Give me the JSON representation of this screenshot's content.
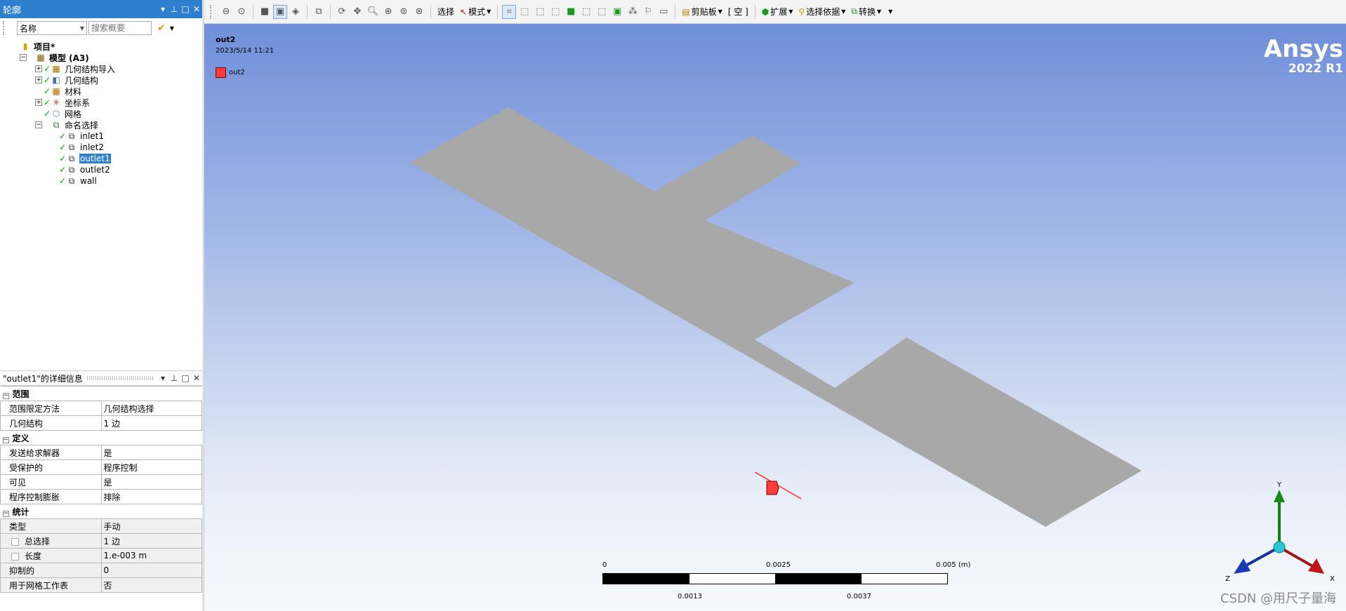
{
  "outline": {
    "title": "轮廓",
    "filter_select": "名称",
    "search_placeholder": "搜索概要",
    "tree": [
      {
        "label": "项目*",
        "bold": true,
        "icon": "project-icon",
        "depth": 0,
        "expander": "",
        "check": false
      },
      {
        "label": "模型 (A3)",
        "bold": true,
        "icon": "model-icon",
        "depth": 1,
        "expander": "−",
        "check": false
      },
      {
        "label": "几何结构导入",
        "icon": "geometry-import-icon",
        "depth": 2,
        "expander": "+",
        "check": true
      },
      {
        "label": "几何结构",
        "icon": "geometry-icon",
        "depth": 2,
        "expander": "+",
        "check": true
      },
      {
        "label": "材料",
        "icon": "materials-icon",
        "depth": 2,
        "expander": "",
        "check": true
      },
      {
        "label": "坐标系",
        "icon": "coordinate-systems-icon",
        "depth": 2,
        "expander": "+",
        "check": true
      },
      {
        "label": "网格",
        "icon": "mesh-icon",
        "depth": 2,
        "expander": "",
        "check": true
      },
      {
        "label": "命名选择",
        "icon": "named-selections-icon",
        "depth": 2,
        "expander": "−",
        "check": false
      },
      {
        "label": "inlet1",
        "icon": "named-selection-icon",
        "depth": 3,
        "expander": "",
        "check": true
      },
      {
        "label": "inlet2",
        "icon": "named-selection-icon",
        "depth": 3,
        "expander": "",
        "check": true
      },
      {
        "label": "outlet1",
        "icon": "named-selection-icon",
        "depth": 3,
        "expander": "",
        "check": true,
        "selected": true
      },
      {
        "label": "outlet2",
        "icon": "named-selection-icon",
        "depth": 3,
        "expander": "",
        "check": true
      },
      {
        "label": "wall",
        "icon": "named-selection-icon",
        "depth": 3,
        "expander": "",
        "check": true
      }
    ]
  },
  "details": {
    "title": "\"outlet1\"的详细信息",
    "groups": [
      {
        "name": "范围",
        "rows": [
          {
            "label": "范围限定方法",
            "value": "几何结构选择"
          },
          {
            "label": "几何结构",
            "value": "1 边"
          }
        ]
      },
      {
        "name": "定义",
        "rows": [
          {
            "label": "发送给求解器",
            "value": "是"
          },
          {
            "label": "受保护的",
            "value": "程序控制"
          },
          {
            "label": "可见",
            "value": "是"
          },
          {
            "label": "程序控制膨胀",
            "value": "排除"
          }
        ]
      },
      {
        "name": "统计",
        "rows": [
          {
            "label": "类型",
            "value": "手动",
            "shaded": true
          },
          {
            "label": "总选择",
            "value": "1 边",
            "shaded": true,
            "checkbox": true
          },
          {
            "label": "长度",
            "value": "1.e-003 m",
            "shaded": true,
            "checkbox": true
          },
          {
            "label": "抑制的",
            "value": "0",
            "shaded": true
          },
          {
            "label": "用于网格工作表",
            "value": "否",
            "shaded": true
          }
        ]
      }
    ]
  },
  "toolbar": {
    "select_label": "选择",
    "mode_label": "模式",
    "clipboard_label": "剪贴板",
    "empty_label": "[ 空 ]",
    "extend_label": "扩展",
    "select_by_label": "选择依据",
    "convert_label": "转换"
  },
  "viewport": {
    "title": "out2",
    "timestamp": "2023/5/14 11:21",
    "legend_label": "out2",
    "legend_color": "#ff3b3b",
    "brand_name": "Ansys",
    "brand_version": "2022 R1",
    "watermark": "CSDN @用尺子量海",
    "geometry_color": "#a8a8a8"
  },
  "scale": {
    "unit": "(m)",
    "top_labels": [
      "0",
      "0.0025",
      "0.005"
    ],
    "bottom_labels": [
      "0.0013",
      "0.0037"
    ]
  },
  "triad": {
    "x": "X",
    "y": "Y",
    "z": "Z"
  }
}
